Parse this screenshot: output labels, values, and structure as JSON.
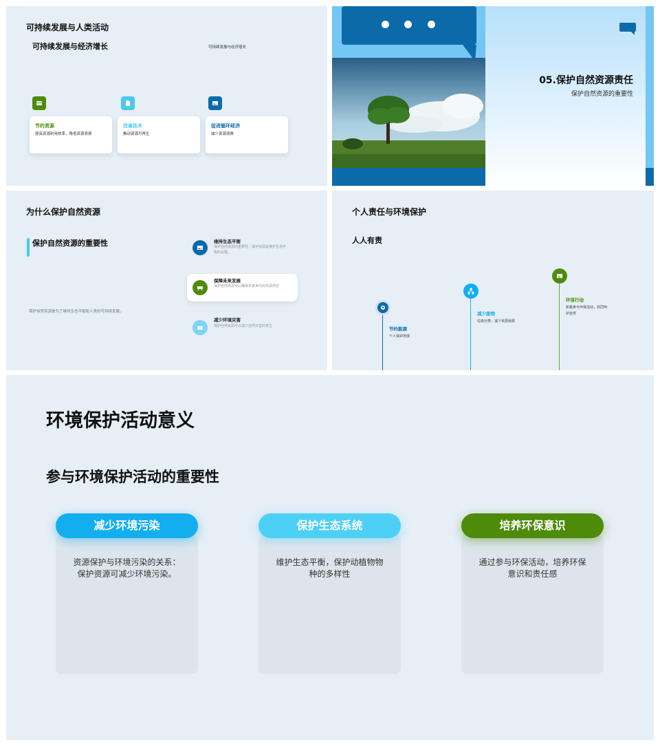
{
  "slide1": {
    "title": "可持续发展与人类活动",
    "subtitle": "可持续发展与经济增长",
    "note": "可持续发展与经济增长",
    "cards": [
      {
        "label": "节约资源",
        "desc": "提高资源利用效率，降低资源浪费",
        "icon": "box-icon",
        "color": "#4e8b0b"
      },
      {
        "label": "改善技术",
        "desc": "推动资源可再生",
        "icon": "document-icon",
        "color": "#4cc9f0"
      },
      {
        "label": "促进循环经济",
        "desc": "减少资源浪费",
        "icon": "image-icon",
        "color": "#0d6aa8"
      }
    ]
  },
  "slide2": {
    "title": "05.保护自然资源责任",
    "subtitle": "保护自然资源的重要性",
    "bubble_icon": "chat-bubble-icon",
    "accent": "#0d6aa8"
  },
  "slide3": {
    "title": "为什么保护自然资源",
    "subtitle": "保护自然资源的重要性",
    "summary": "保护自然资源是为了维持生态平衡和人类的可持续发展。",
    "items": [
      {
        "heading": "维持生态平衡",
        "desc": "保护自然资源的重要性：保护资源是维护生态平衡的关键。",
        "icon": "image-icon"
      },
      {
        "heading": "保障未来发展",
        "desc": "保护自然资源可以确保未来世代的资源供应",
        "icon": "sofa-icon"
      },
      {
        "heading": "减少环境灾害",
        "desc": "保护自然资源可以减少自然灾害的发生",
        "icon": "keyboard-icon"
      }
    ]
  },
  "slide4": {
    "title": "个人责任与环境保护",
    "subtitle": "人人有责",
    "timeline": [
      {
        "heading": "节约能源",
        "desc": "个人保护地球",
        "icon": "gear-icon",
        "color": "#0d6aa8"
      },
      {
        "heading": "减少废物",
        "desc": "垃圾分类，减少资源浪费",
        "icon": "hierarchy-icon",
        "color": "#12aef0"
      },
      {
        "heading": "环保行动",
        "desc": "积极参与环保活动，共同呵护自然",
        "icon": "image-icon",
        "color": "#4e8b0b"
      }
    ]
  },
  "slide5": {
    "title": "环境保护活动意义",
    "subtitle": "参与环境保护活动的重要性",
    "cards": [
      {
        "label": "减少环境污染",
        "desc": "资源保护与环境污染的关系：保护资源可减少环境污染。",
        "color": "#12aef0"
      },
      {
        "label": "保护生态系统",
        "desc": "维护生态平衡，保护动植物物种的多样性",
        "color": "#4dd0f5"
      },
      {
        "label": "培养环保意识",
        "desc": "通过参与环保活动，培养环保意识和责任感",
        "color": "#4e8b0b"
      }
    ]
  }
}
